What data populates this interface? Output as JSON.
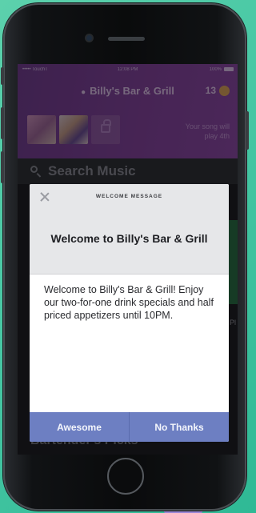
{
  "status_bar": {
    "carrier": "••••• TouchT",
    "time": "12:08 PM",
    "battery": "100%"
  },
  "header": {
    "venue_name": "Billy's Bar & Grill",
    "credits": "13",
    "song_note": "Your song will play 4th"
  },
  "search": {
    "placeholder": "Search Music"
  },
  "background_section": {
    "title": "Bartender's Picks",
    "right_peek_label": "Pl"
  },
  "modal": {
    "header_label": "WELCOME MESSAGE",
    "title": "Welcome to Billy's Bar & Grill",
    "message": "Welcome to Billy's Bar & Grill! Enjoy our two-for-one drink specials and half priced appetizers until 10PM.",
    "primary_button": "Awesome",
    "secondary_button": "No Thanks"
  },
  "colors": {
    "header_purple": "#7a3f92",
    "button_blue": "#6d7fc2",
    "coin_gold": "#e8b93a",
    "background_teal": "#47c7a4"
  },
  "icons": [
    "pin-icon",
    "coin-icon",
    "lock-icon",
    "search-icon",
    "close-icon"
  ]
}
